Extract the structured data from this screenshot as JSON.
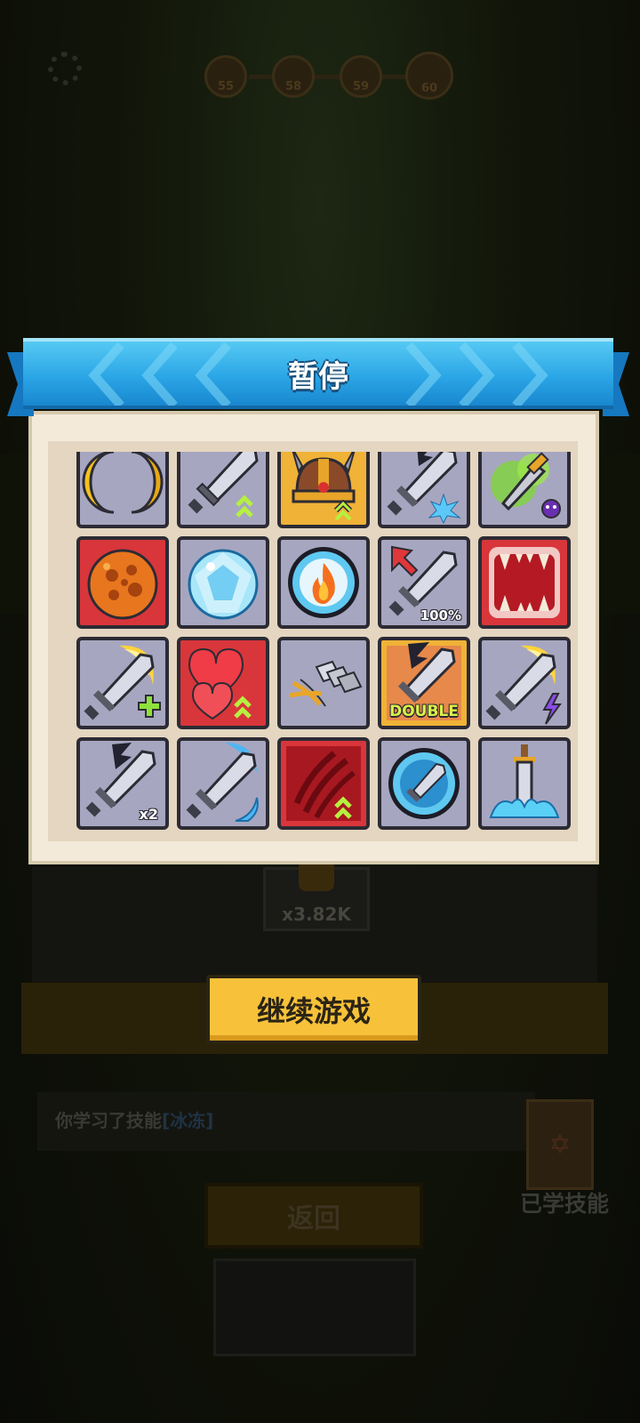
{
  "top": {
    "levels": [
      "55",
      "58",
      "59",
      "60"
    ]
  },
  "pause_dialog": {
    "title": "暂停",
    "skills": [
      {
        "icon": "crescent-moon-icon",
        "color": "gray"
      },
      {
        "icon": "sword-upgrade-icon",
        "color": "gray"
      },
      {
        "icon": "viking-helmet-upgrade-icon",
        "color": "gold"
      },
      {
        "icon": "shadow-sword-ice-icon",
        "color": "gray"
      },
      {
        "icon": "poison-dagger-icon",
        "color": "gray"
      },
      {
        "icon": "lava-orb-icon",
        "color": "red"
      },
      {
        "icon": "ice-orb-icon",
        "color": "gray"
      },
      {
        "icon": "fire-bubble-icon",
        "color": "gray"
      },
      {
        "icon": "sword-crit-icon",
        "color": "gray",
        "badge": "100%"
      },
      {
        "icon": "fanged-maw-icon",
        "color": "red"
      },
      {
        "icon": "golden-slash-sword-plus-icon",
        "color": "gray"
      },
      {
        "icon": "hearts-upgrade-icon",
        "color": "red"
      },
      {
        "icon": "triple-blades-icon",
        "color": "gray"
      },
      {
        "icon": "double-strike-sword-icon",
        "color": "gold",
        "badge": "DOUBLE"
      },
      {
        "icon": "golden-slash-sword-lightning-icon",
        "color": "gray"
      },
      {
        "icon": "shadow-sword-x2-icon",
        "color": "gray",
        "badge": "x2"
      },
      {
        "icon": "frost-sword-icon",
        "color": "gray"
      },
      {
        "icon": "claw-slash-upgrade-icon",
        "color": "red"
      },
      {
        "icon": "sword-bubble-icon",
        "color": "gray"
      },
      {
        "icon": "sword-splash-icon",
        "color": "gray"
      }
    ],
    "continue_label": "继续游戏"
  },
  "background": {
    "coin_count": "x3.82K",
    "message_prefix": "你学习了技能",
    "message_skill": "[冰冻]",
    "learned_skills_label": "已学技能",
    "back_label": "返回"
  }
}
